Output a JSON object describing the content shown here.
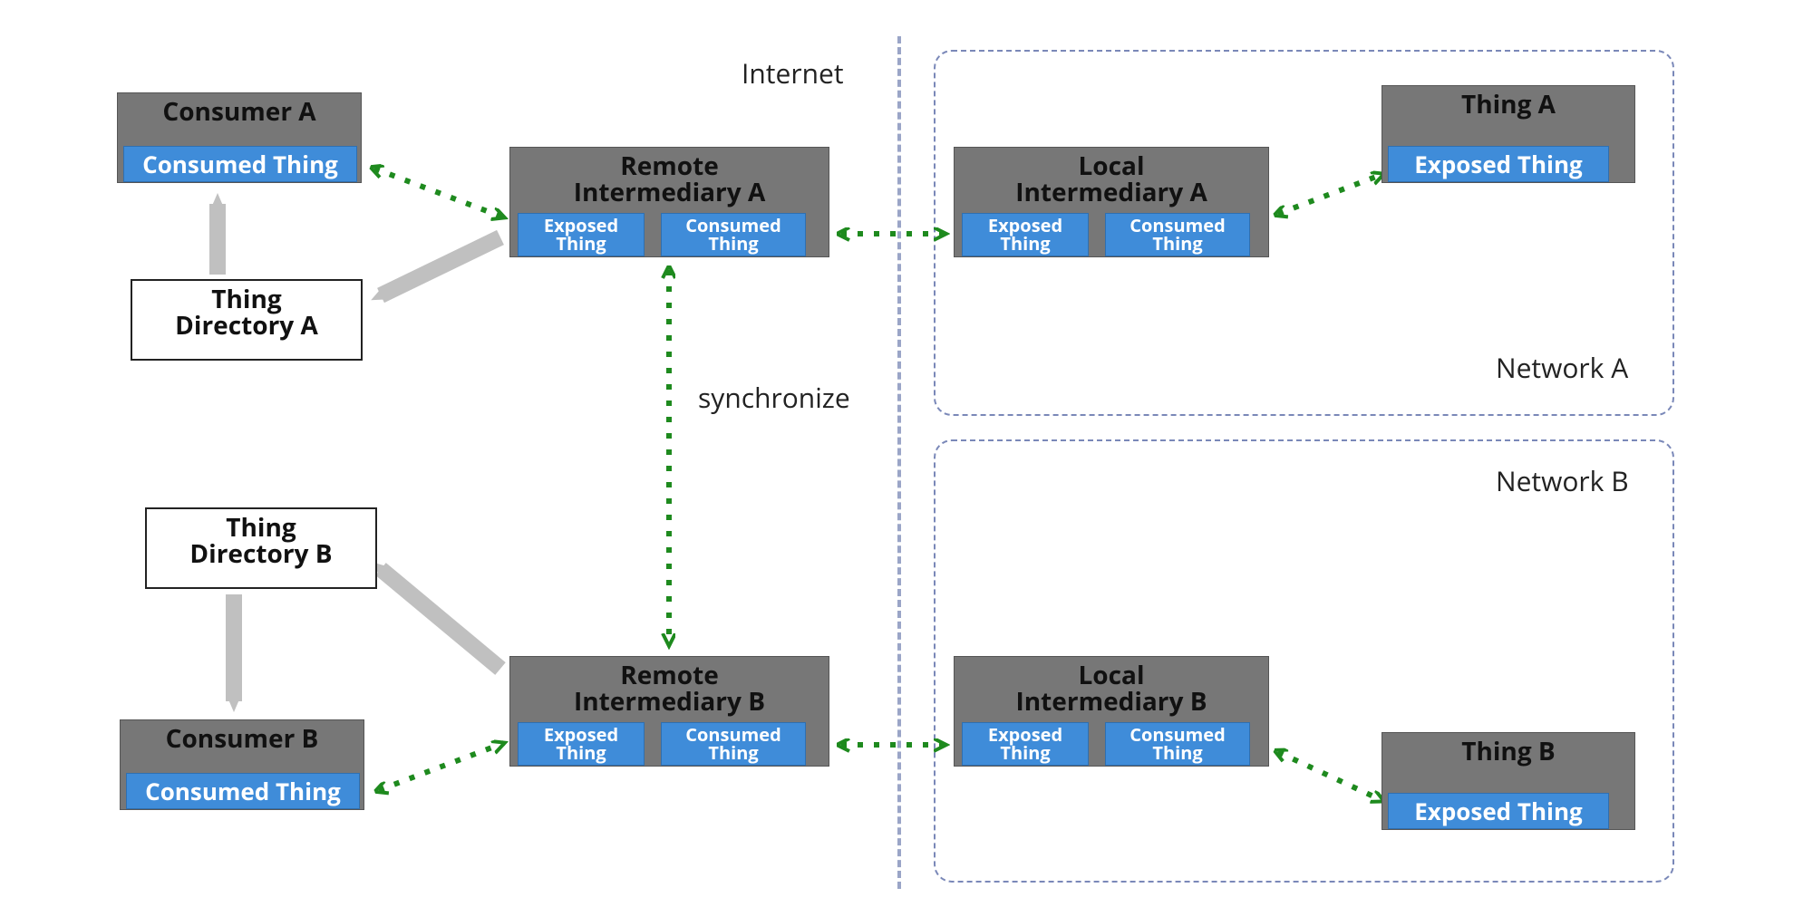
{
  "labels": {
    "internet": "Internet",
    "synchronize": "synchronize",
    "network_a": "Network A",
    "network_b": "Network B"
  },
  "boxes": {
    "consumer_a": "Consumer A",
    "consumer_b": "Consumer B",
    "thing_dir_a": "Thing\nDirectory A",
    "thing_dir_b": "Thing\nDirectory B",
    "remote_a": "Remote\nIntermediary A",
    "remote_b": "Remote\nIntermediary B",
    "local_a": "Local\nIntermediary A",
    "local_b": "Local\nIntermediary B",
    "thing_a": "Thing A",
    "thing_b": "Thing B"
  },
  "subs": {
    "consumed_thing": "Consumed Thing",
    "exposed_thing": "Exposed Thing",
    "exposed_small": "Exposed\nThing",
    "consumed_small": "Consumed\nThing"
  },
  "colors": {
    "gray": "#777777",
    "blue": "#3f8cd9",
    "arrow_green": "#1e8a1e",
    "arrow_gray": "#c0c0c0",
    "dash_border": "#7a88b8"
  }
}
